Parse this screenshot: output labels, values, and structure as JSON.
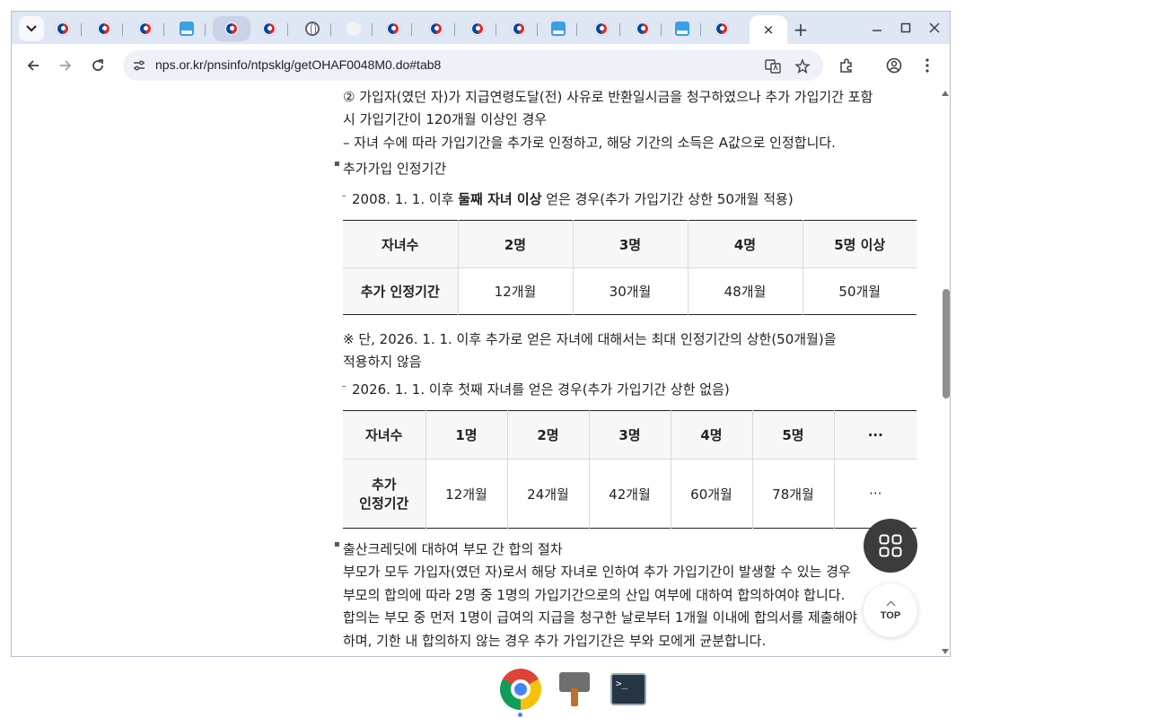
{
  "browser": {
    "url": "nps.or.kr/pnsinfo/ntpsklg/getOHAF0048M0.do#tab8",
    "tab_count_visible": 17,
    "new_tab_symbol": "+",
    "close_symbol": "×"
  },
  "page": {
    "intro_line1": "② 가입자(였던 자)가 지급연령도달(전) 사유로 반환일시금을 청구하였으나 추가 가입기간 포함",
    "intro_line2": "시 가입기간이 120개월 이상인 경우",
    "intro_line3": " – 자녀 수에 따라 가입기간을 추가로 인정하고, 해당 기간의 소득은 A값으로 인정합니다.",
    "section_title": "추가가입 인정기간",
    "rule1_pre": "2008. 1. 1. 이후 ",
    "rule1_bold": "둘째 자녀 이상",
    "rule1_post": " 얻은 경우(추가 가입기간 상한 50개월 적용)",
    "table1": {
      "header_label": "자녀수",
      "headers": [
        "2명",
        "3명",
        "4명",
        "5명 이상"
      ],
      "row_label": "추가 인정기간",
      "values": [
        "12개월",
        "30개월",
        "48개월",
        "50개월"
      ]
    },
    "note_line1": "  ※ 단, 2026. 1. 1. 이후 추가로 얻은 자녀에 대해서는 최대 인정기간의 상한(50개월)을",
    "note_line2": "적용하지 않음",
    "rule2": "2026. 1. 1. 이후 첫째 자녀를 얻은 경우(추가 가입기간 상한 없음)",
    "table2": {
      "header_label": "자녀수",
      "headers": [
        "1명",
        "2명",
        "3명",
        "4명",
        "5명",
        "···"
      ],
      "row_label_1": "추가",
      "row_label_2": "인정기간",
      "values": [
        "12개월",
        "24개월",
        "42개월",
        "60개월",
        "78개월",
        "···"
      ]
    },
    "agreement_title": "출산크레딧에 대하여 부모 간 합의 절차",
    "agreement_line1": "부모가 모두 가입자(였던 자)로서 해당 자녀로 인하여 추가 가입기간이 발생할 수 있는 경우",
    "agreement_line2": "부모의 합의에 따라 2명 중 1명의 가입기간으로의 산입 여부에 대하여 합의하여야 합니다.",
    "agreement_line3": "합의는 부모 중 먼저 1명이 급여의 지급을 청구한 날로부터 1개월 이내에 합의서를 제출해야",
    "agreement_line4": "하며, 기한 내 합의하지 않는 경우 추가 가입기간은 부와 모에게 균분합니다."
  },
  "floating": {
    "top_label": "TOP"
  },
  "taskbar": {
    "terminal_prompt": ">_"
  }
}
